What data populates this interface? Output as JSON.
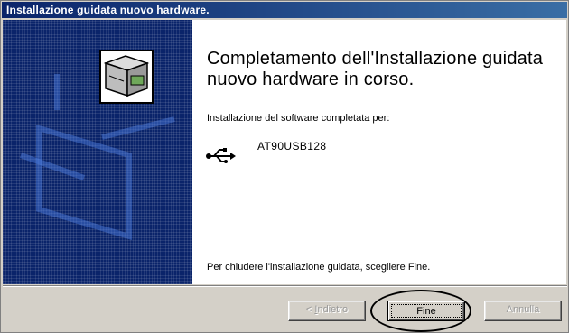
{
  "window": {
    "title": "Installazione guidata nuovo hardware."
  },
  "main": {
    "headline": "Completamento dell'Installazione guidata nuovo hardware in corso.",
    "software_complete_label": "Installazione del software completata per:",
    "device_name": "AT90USB128",
    "closing_instruction": "Per chiudere l'installazione guidata, scegliere Fine."
  },
  "icons": {
    "wizard": "hardware-box-icon",
    "device": "usb-icon"
  },
  "buttons": {
    "back_prefix": "< ",
    "back_accel": "I",
    "back_rest": "ndietro",
    "finish": "Fine",
    "cancel": "Annulla"
  },
  "colors": {
    "titlebar": "#0a246a",
    "panel": "#0a246a",
    "dialog_face": "#d4d0c8"
  }
}
